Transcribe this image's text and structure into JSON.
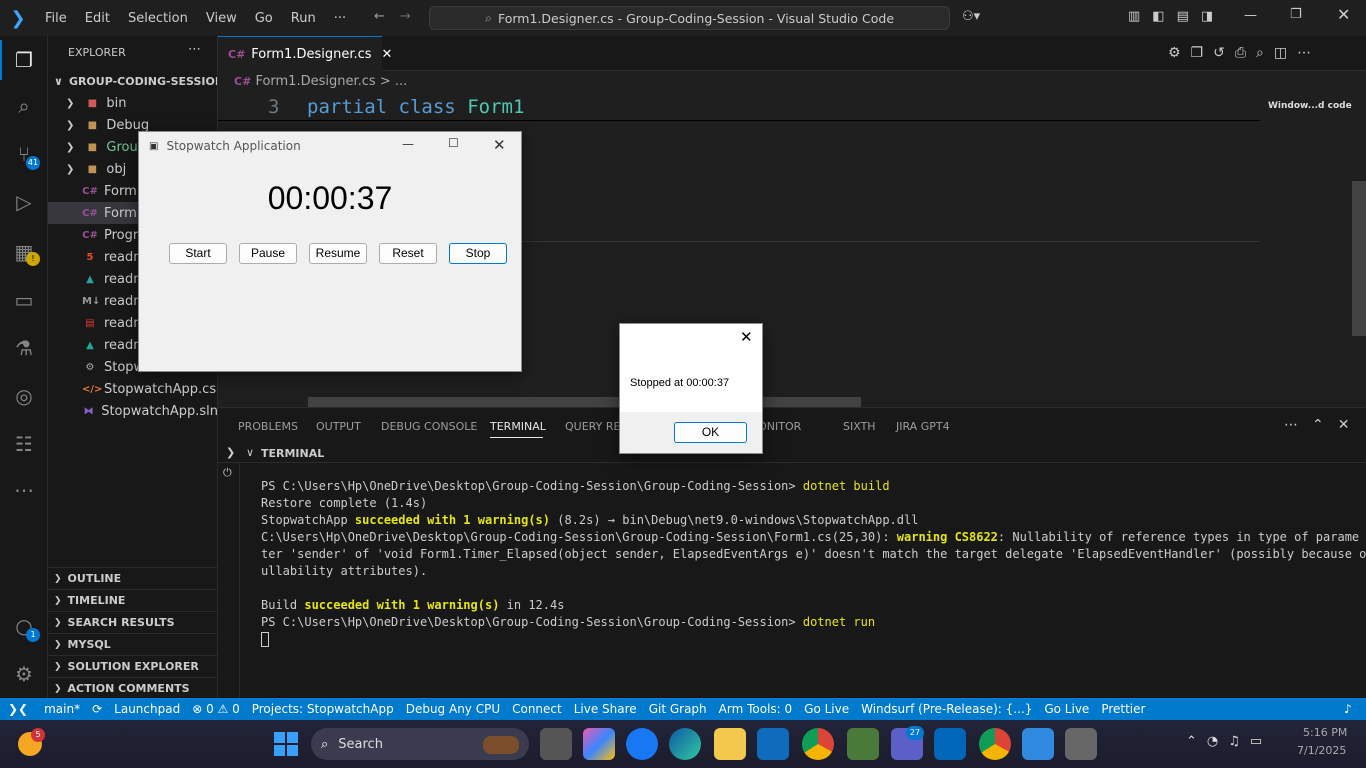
{
  "titlebar": {
    "menu": [
      "File",
      "Edit",
      "Selection",
      "View",
      "Go",
      "Run",
      "···"
    ],
    "command_center": "Form1.Designer.cs - Group-Coding-Session - Visual Studio Code"
  },
  "activity_bar": {
    "source_control_badge": "41",
    "accounts_badge": "1"
  },
  "explorer": {
    "header": "EXPLORER",
    "root": "GROUP-CODING-SESSION",
    "items": [
      {
        "label": "bin",
        "icon": "folder-bin-icon",
        "indent": 1,
        "chev": true
      },
      {
        "label": "Debug",
        "icon": "folder-icon",
        "indent": 1,
        "chev": true
      },
      {
        "label": "Group",
        "icon": "folder-icon",
        "indent": 1,
        "chev": true,
        "color": "#73c991"
      },
      {
        "label": "obj",
        "icon": "folder-icon",
        "indent": 1,
        "chev": true
      },
      {
        "label": "Form1",
        "icon": "csharp-icon",
        "indent": 1
      },
      {
        "label": "Form1",
        "icon": "csharp-icon",
        "indent": 1,
        "selected": true
      },
      {
        "label": "Progra",
        "icon": "csharp-icon",
        "indent": 1
      },
      {
        "label": "readm",
        "icon": "html-icon",
        "indent": 1
      },
      {
        "label": "readm",
        "icon": "image-icon",
        "indent": 1
      },
      {
        "label": "readm",
        "icon": "markdown-icon",
        "indent": 1
      },
      {
        "label": "readm",
        "icon": "pdf-icon",
        "indent": 1
      },
      {
        "label": "readm",
        "icon": "image-icon",
        "indent": 1
      },
      {
        "label": "Stopwatch",
        "icon": "rss-icon",
        "indent": 1
      },
      {
        "label": "StopwatchApp.cs...",
        "icon": "xml-icon",
        "indent": 1
      },
      {
        "label": "StopwatchApp.sln",
        "icon": "vs-icon",
        "indent": 1
      }
    ],
    "sections": [
      "OUTLINE",
      "TIMELINE",
      "SEARCH RESULTS",
      "MYSQL",
      "SOLUTION EXPLORER",
      "ACTION COMMENTS"
    ]
  },
  "editor": {
    "tab_label": "Form1.Designer.cs",
    "breadcrumb": "Form1.Designer.cs",
    "breadcrumb_more": "...",
    "line_number": "3",
    "code_keyword1": "partial",
    "code_keyword2": "class",
    "code_name": "Form1",
    "minimap_label": "Window...d code"
  },
  "panel": {
    "tabs": [
      "PROBLEMS",
      "OUTPUT",
      "DEBUG CONSOLE",
      "TERMINAL",
      "QUERY RES",
      "L MONITOR",
      "SIXTH",
      "JIRA GPT4"
    ],
    "active_tab": "TERMINAL",
    "section_title": "TERMINAL",
    "lines": [
      {
        "prefix": "PS C:\\Users\\Hp\\OneDrive\\Desktop\\Group-Coding-Session\\Group-Coding-Session> ",
        "cmd": "dotnet build"
      },
      {
        "text": "Restore complete (1.4s)"
      },
      {
        "pre": "  StopwatchApp ",
        "hl": "succeeded with 1 warning(s)",
        "post": " (8.2s) → bin\\Debug\\net9.0-windows\\StopwatchApp.dll"
      },
      {
        "pre": "    C:\\Users\\Hp\\OneDrive\\Desktop\\Group-Coding-Session\\Group-Coding-Session\\Form1.cs(25,30): ",
        "hl": "warning CS8622",
        "post": ": Nullability of reference types in type of parame"
      },
      {
        "text": "ter 'sender' of 'void Form1.Timer_Elapsed(object sender, ElapsedEventArgs e)' doesn't match the target delegate 'ElapsedEventHandler' (possibly because of n"
      },
      {
        "text": "ullability attributes)."
      },
      {
        "text": ""
      },
      {
        "pre": "Build ",
        "hl": "succeeded with 1 warning(s)",
        "post": " in 12.4s"
      },
      {
        "prefix": "PS C:\\Users\\Hp\\OneDrive\\Desktop\\Group-Coding-Session\\Group-Coding-Session> ",
        "cmd": "dotnet run"
      }
    ]
  },
  "statusbar": {
    "items": [
      "main*",
      "⟳",
      "Launchpad",
      "⊗ 0 ⚠ 0",
      "Projects: StopwatchApp",
      "Debug Any CPU",
      "Connect",
      "Live Share",
      "Git Graph",
      "Arm Tools: 0",
      "Go Live",
      "Windsurf (Pre-Release): {...}",
      "Go Live",
      "Prettier"
    ]
  },
  "stopwatch_window": {
    "title": "Stopwatch Application",
    "time": "00:00:37",
    "buttons": [
      "Start",
      "Pause",
      "Resume",
      "Reset",
      "Stop"
    ]
  },
  "message_box": {
    "text": "Stopped at 00:00:37",
    "ok_label": "OK"
  },
  "taskbar": {
    "weather_badge": "5",
    "search_placeholder": "Search",
    "teams_badge": "27",
    "time": "5:16 PM",
    "date": "7/1/2025"
  }
}
